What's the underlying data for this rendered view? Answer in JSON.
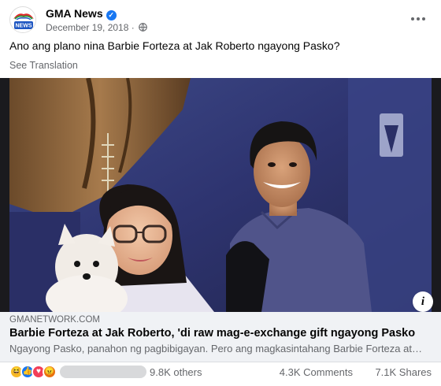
{
  "post": {
    "page_name": "GMA News",
    "date": "December 19, 2018",
    "separator": "·",
    "text": "Ano ang plano nina Barbie Forteza at Jak Roberto ngayong Pasko?",
    "see_translation": "See Translation"
  },
  "avatar": {
    "text": "GMA",
    "sub": "NEWS"
  },
  "link": {
    "domain": "GMANETWORK.COM",
    "title": "Barbie Forteza at Jak Roberto, 'di raw mag-e-exchange gift ngayong Pasko",
    "description": "Ngayong Pasko, panahon ng pagbibigayan. Pero ang magkasintahang Barbie Forteza at Jak Roberto, hindi raw mag-e-exchange gift."
  },
  "footer": {
    "reaction_icons": [
      "haha",
      "like",
      "love",
      "angry"
    ],
    "others": "9.8K others",
    "comments": "4.3K Comments",
    "shares": "7.1K Shares"
  },
  "colors": {
    "accent": "#1877f2",
    "secondary_text": "#65676b",
    "link_box_bg": "#f0f2f5"
  }
}
